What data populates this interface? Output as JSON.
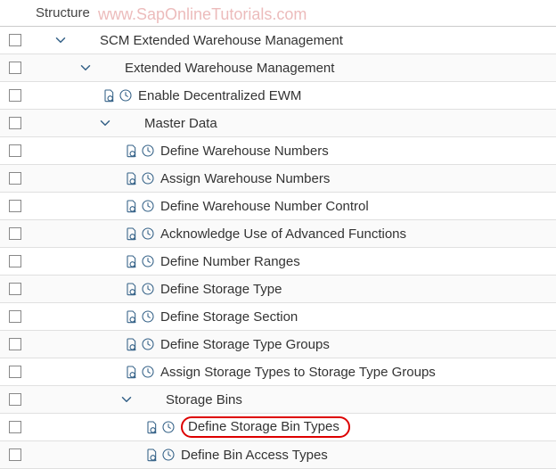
{
  "header": {
    "title": "Structure"
  },
  "watermark": "www.SapOnlineTutorials.com",
  "rows": [
    {
      "indent": 22,
      "expander": true,
      "icons": false,
      "label": "SCM Extended Warehouse Management",
      "name": "node-scm-ewm",
      "highlight": false
    },
    {
      "indent": 50,
      "expander": true,
      "icons": false,
      "label": "Extended Warehouse Management",
      "name": "node-ewm",
      "highlight": false
    },
    {
      "indent": 80,
      "expander": false,
      "icons": true,
      "label": "Enable Decentralized EWM",
      "name": "node-enable-decentralized-ewm",
      "highlight": false
    },
    {
      "indent": 72,
      "expander": true,
      "icons": false,
      "label": "Master Data",
      "name": "node-master-data",
      "highlight": false
    },
    {
      "indent": 105,
      "expander": false,
      "icons": true,
      "label": "Define Warehouse Numbers",
      "name": "node-define-warehouse-numbers",
      "highlight": false
    },
    {
      "indent": 105,
      "expander": false,
      "icons": true,
      "label": "Assign Warehouse Numbers",
      "name": "node-assign-warehouse-numbers",
      "highlight": false
    },
    {
      "indent": 105,
      "expander": false,
      "icons": true,
      "label": "Define Warehouse Number Control",
      "name": "node-define-warehouse-number-control",
      "highlight": false
    },
    {
      "indent": 105,
      "expander": false,
      "icons": true,
      "label": "Acknowledge Use of Advanced Functions",
      "name": "node-acknowledge-advanced-functions",
      "highlight": false
    },
    {
      "indent": 105,
      "expander": false,
      "icons": true,
      "label": "Define Number Ranges",
      "name": "node-define-number-ranges",
      "highlight": false
    },
    {
      "indent": 105,
      "expander": false,
      "icons": true,
      "label": "Define Storage Type",
      "name": "node-define-storage-type",
      "highlight": false
    },
    {
      "indent": 105,
      "expander": false,
      "icons": true,
      "label": "Define Storage Section",
      "name": "node-define-storage-section",
      "highlight": false
    },
    {
      "indent": 105,
      "expander": false,
      "icons": true,
      "label": "Define Storage Type Groups",
      "name": "node-define-storage-type-groups",
      "highlight": false
    },
    {
      "indent": 105,
      "expander": false,
      "icons": true,
      "label": "Assign Storage Types to Storage Type Groups",
      "name": "node-assign-storage-types-groups",
      "highlight": false
    },
    {
      "indent": 96,
      "expander": true,
      "icons": false,
      "label": "Storage Bins",
      "name": "node-storage-bins",
      "highlight": false
    },
    {
      "indent": 128,
      "expander": false,
      "icons": true,
      "label": "Define Storage Bin Types",
      "name": "node-define-storage-bin-types",
      "highlight": true
    },
    {
      "indent": 128,
      "expander": false,
      "icons": true,
      "label": "Define Bin Access Types",
      "name": "node-define-bin-access-types",
      "highlight": false
    }
  ]
}
